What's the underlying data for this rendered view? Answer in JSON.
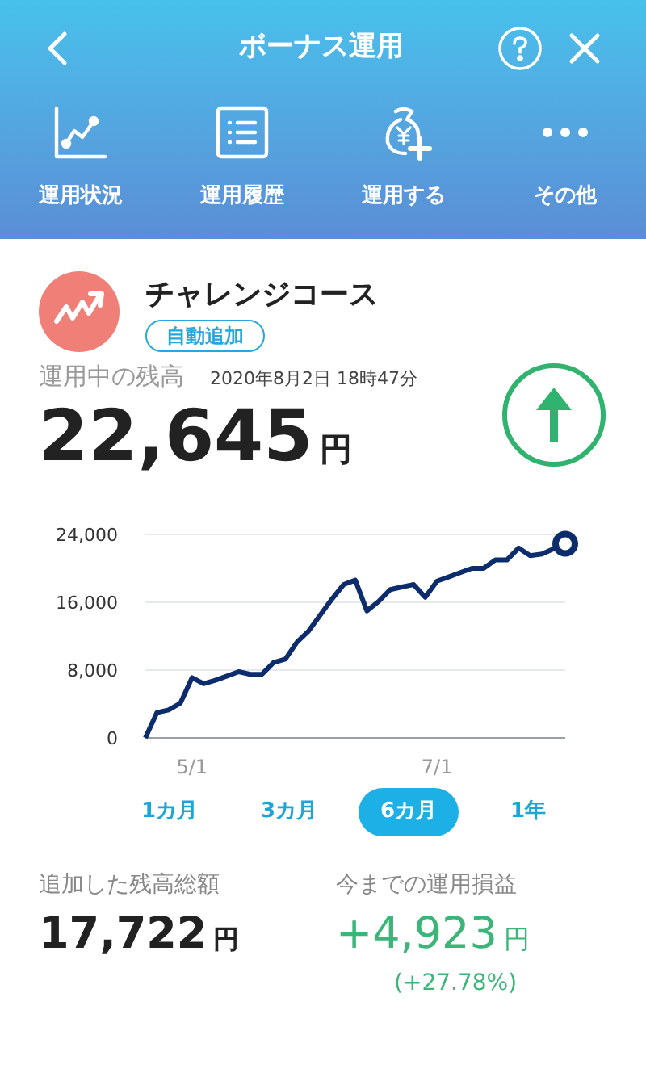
{
  "header": {
    "title": "ボーナス運用"
  },
  "nav_items": [
    {
      "kind": "chart",
      "label": "運用状況"
    },
    {
      "kind": "list",
      "label": "運用履歴"
    },
    {
      "kind": "invest",
      "label": "運用する"
    },
    {
      "kind": "more",
      "label": "その他"
    }
  ],
  "course": {
    "name": "チャレンジコース",
    "badge": "自動追加"
  },
  "balance": {
    "label": "運用中の残高",
    "timestamp": "2020年8月2日 18時47分",
    "amount": "22,645",
    "unit": "円",
    "rising": true
  },
  "chart_data": {
    "type": "line",
    "ylim": [
      0,
      24000
    ],
    "categories": [
      null,
      null,
      null,
      null,
      "5/1",
      null,
      null,
      null,
      null,
      null,
      null,
      null,
      null,
      null,
      null,
      null,
      null,
      null,
      null,
      null,
      null,
      null,
      null,
      null,
      null,
      "7/1",
      null,
      null,
      null,
      null,
      null,
      null,
      null,
      null,
      null,
      null,
      null
    ],
    "yticks": [
      0,
      {
        "value": 8000,
        "label": "8,000"
      },
      {
        "value": 16000,
        "label": "16,000"
      },
      {
        "value": 24000,
        "label": "24,000"
      }
    ],
    "series": [
      {
        "color": "#0d2c6b",
        "values": [
          0,
          3000,
          3300,
          4100,
          7100,
          6400,
          6800,
          7300,
          7800,
          7500,
          7500,
          8900,
          9300,
          11300,
          12600,
          14500,
          16400,
          18100,
          18600,
          15000,
          16100,
          17500,
          17800,
          18100,
          16600,
          18500,
          19000,
          19500,
          20000,
          20000,
          21000,
          21000,
          22400,
          21500,
          21700,
          22300,
          22900
        ]
      }
    ]
  },
  "periods": [
    {
      "label": "1カ月",
      "selected": false
    },
    {
      "label": "3カ月",
      "selected": false
    },
    {
      "label": "6カ月",
      "selected": true
    },
    {
      "label": "1年",
      "selected": false
    }
  ],
  "added": {
    "label": "追加した残高総額",
    "amount": "17,722",
    "unit": "円"
  },
  "profit": {
    "label": "今までの運用損益",
    "amount": "+4,923",
    "unit": "円",
    "percent": "(+27.78%)"
  }
}
